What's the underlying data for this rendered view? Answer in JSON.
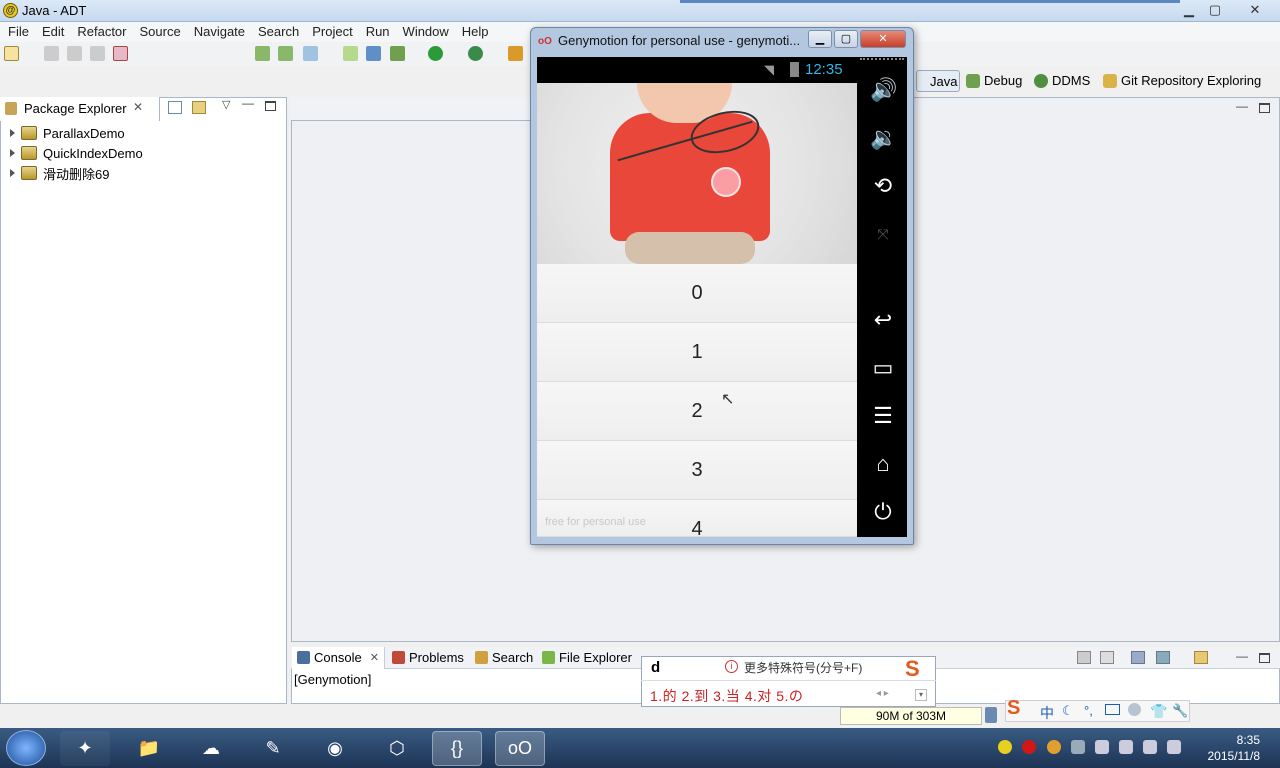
{
  "window": {
    "title": "Java - ADT",
    "minimize": "▁",
    "maximize": "▢",
    "close": "✕"
  },
  "menu": [
    "File",
    "Edit",
    "Refactor",
    "Source",
    "Navigate",
    "Search",
    "Project",
    "Run",
    "Window",
    "Help"
  ],
  "perspectives": {
    "java": "Java",
    "debug": "Debug",
    "ddms": "DDMS",
    "git": "Git Repository Exploring"
  },
  "package_explorer": {
    "title": "Package Explorer",
    "projects": [
      "ParallaxDemo",
      "QuickIndexDemo",
      "滑动删除69"
    ]
  },
  "genymotion": {
    "title": "Genymotion for personal use - genymoti...",
    "clock": "12:35",
    "list_items": [
      "0",
      "1",
      "2",
      "3",
      "4"
    ],
    "watermark": "free for personal use"
  },
  "console": {
    "tabs": [
      "Console",
      "Problems",
      "Search",
      "File Explorer"
    ],
    "content": "[Genymotion]"
  },
  "ime": {
    "input": "d",
    "hint": "更多特殊符号(分号+F)",
    "candidates": "1.的  2.到  3.当  4.对  5.の"
  },
  "memory": "90M of 303M",
  "taskbar": {
    "time": "8:35",
    "date": "2015/11/8"
  },
  "colors": {
    "accent": "#33b5e5",
    "shirt": "#e9473a",
    "title_bar": "#dce9f7"
  }
}
